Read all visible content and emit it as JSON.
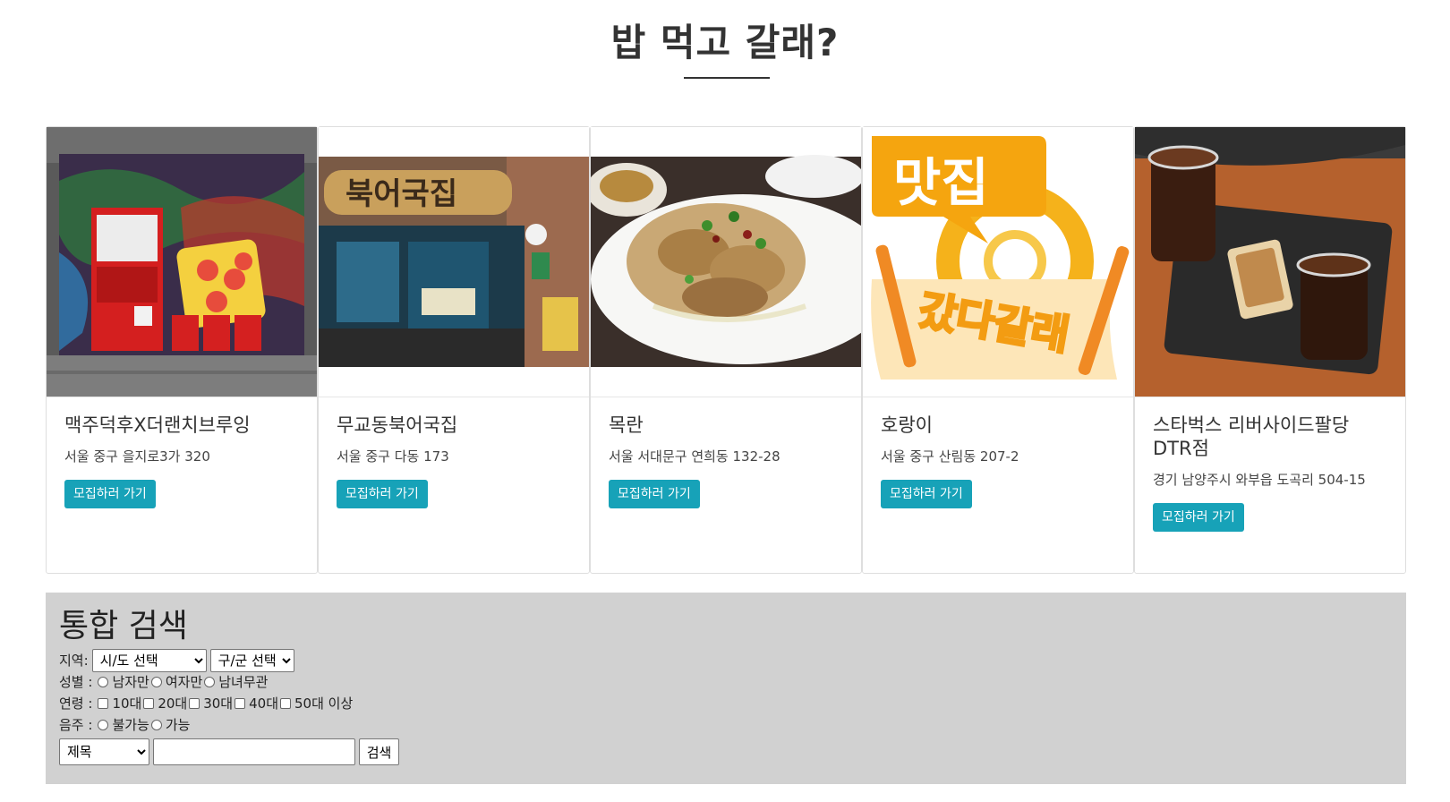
{
  "header": {
    "title": "밥 먹고 갈래?"
  },
  "cards": [
    {
      "name": "맥주덕후X더랜치브루잉",
      "address": "서울 중구 을지로3가 320",
      "button": "모집하러 가기",
      "image": "graffiti-storefront-image"
    },
    {
      "name": "무교동북어국집",
      "address": "서울 중구 다동 173",
      "button": "모집하러 가기",
      "image": "restaurant-signboard-image"
    },
    {
      "name": "목란",
      "address": "서울 서대문구 연희동 132-28",
      "button": "모집하러 가기",
      "image": "fried-dish-image"
    },
    {
      "name": "호랑이",
      "address": "서울 중구 산림동 207-2",
      "button": "모집하러 가기",
      "image": "matjip-logo-image",
      "logo_top": "맛집",
      "logo_bottom": "갔다갈래"
    },
    {
      "name": "스타벅스 리버사이드팔당DTR점",
      "address": "경기 남양주시 와부읍 도곡리 504-15",
      "button": "모집하러 가기",
      "image": "iced-coffee-tray-image"
    }
  ],
  "search": {
    "title": "통합 검색",
    "region_label": "지역:",
    "sido_select": "시/도 선택",
    "gugun_select": "구/군 선택",
    "gender_label": "성별 :",
    "gender_options": [
      "남자만",
      "여자만",
      "남녀무관"
    ],
    "age_label": "연령 :",
    "age_options": [
      "10대",
      "20대",
      "30대",
      "40대",
      "50대 이상"
    ],
    "drink_label": "음주 :",
    "drink_options": [
      "불가능",
      "가능"
    ],
    "field_select": "제목",
    "query_value": "",
    "search_button": "검색"
  },
  "colors": {
    "button": "#17a2b8",
    "panel": "#d1d1d1",
    "heading": "#333333"
  }
}
